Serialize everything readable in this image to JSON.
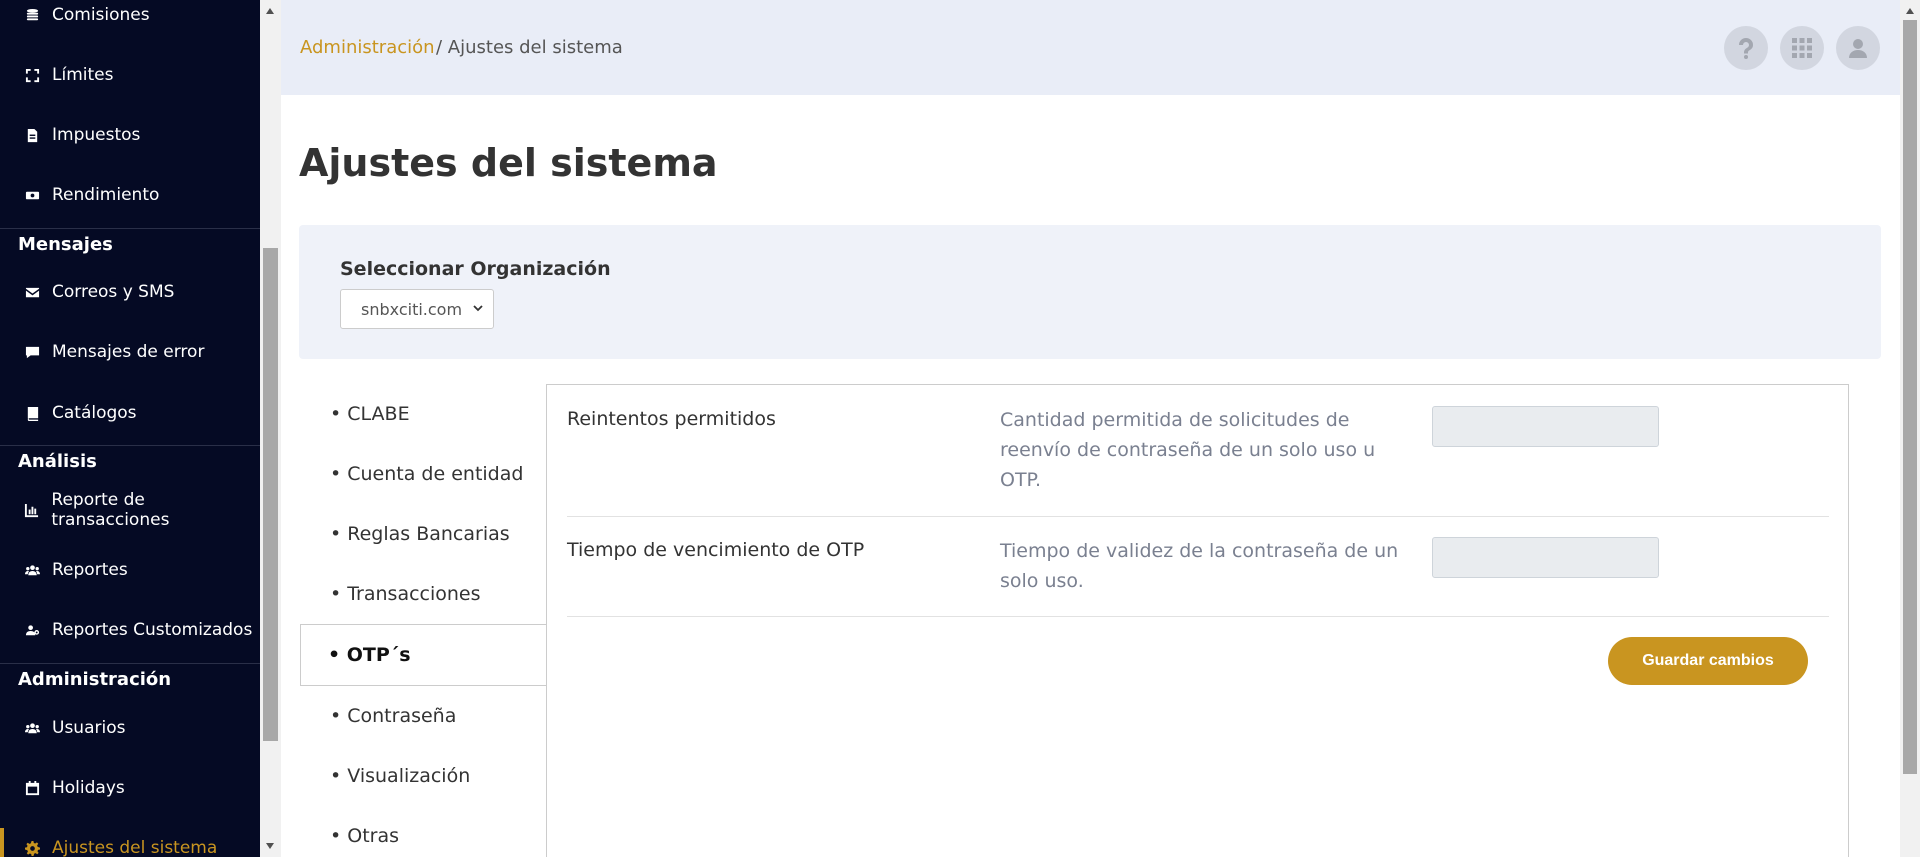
{
  "sidebar": {
    "items": [
      {
        "label": "Comisiones",
        "icon": "coins-icon"
      },
      {
        "label": "Límites",
        "icon": "expand-icon"
      },
      {
        "label": "Impuestos",
        "icon": "document-icon"
      },
      {
        "label": "Rendimiento",
        "icon": "money-icon"
      },
      {
        "label": "Correos y SMS",
        "icon": "envelope-icon"
      },
      {
        "label": "Mensajes de error",
        "icon": "comment-icon"
      },
      {
        "label": "Catálogos",
        "icon": "book-icon"
      },
      {
        "label": "Reporte de transacciones",
        "icon": "chart-icon"
      },
      {
        "label": "Reportes",
        "icon": "users-icon"
      },
      {
        "label": "Reportes Customizados",
        "icon": "users-gear-icon"
      },
      {
        "label": "Usuarios",
        "icon": "users-icon"
      },
      {
        "label": "Holidays",
        "icon": "calendar-icon"
      },
      {
        "label": "Ajustes del sistema",
        "icon": "gear-icon"
      }
    ],
    "headers": {
      "mensajes": "Mensajes",
      "analisis": "Análisis",
      "administracion": "Administración"
    }
  },
  "topbar": {
    "breadcrumb_link": "Administración",
    "breadcrumb_current": "/ Ajustes del sistema"
  },
  "page": {
    "title": "Ajustes del sistema"
  },
  "organization": {
    "label": "Seleccionar Organización",
    "selected": "snbxciti.com"
  },
  "tabs": [
    {
      "label": "• CLABE"
    },
    {
      "label": "• Cuenta de entidad"
    },
    {
      "label": "• Reglas Bancarias"
    },
    {
      "label": "• Transacciones"
    },
    {
      "label": "• OTP´s"
    },
    {
      "label": "• Contraseña"
    },
    {
      "label": "• Visualización"
    },
    {
      "label": "• Otras"
    }
  ],
  "settings": [
    {
      "name": "Reintentos permitidos",
      "description": "Cantidad permitida de solicitudes de reenvío de contraseña de un solo uso u OTP.",
      "value": ""
    },
    {
      "name": "Tiempo de vencimiento de OTP",
      "description": "Tiempo de validez de la contraseña de un solo uso.",
      "value": ""
    }
  ],
  "save_label": "Guardar cambios",
  "colors": {
    "accent": "#c99520",
    "sidebar_bg": "#050a24",
    "topbar_bg": "#e9edf7"
  }
}
